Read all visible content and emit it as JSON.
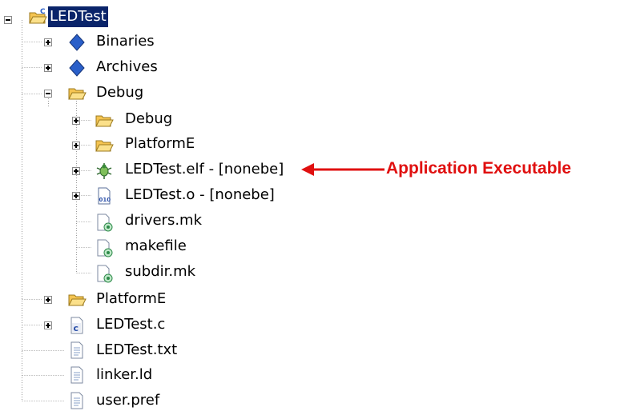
{
  "tree": {
    "root": {
      "label": "LEDTest",
      "icon": "c-project-folder-icon",
      "toggle": "-"
    },
    "items": [
      {
        "label": "Binaries",
        "icon": "binaries-icon",
        "toggle": "+"
      },
      {
        "label": "Archives",
        "icon": "archives-icon",
        "toggle": "+"
      },
      {
        "label": "Debug",
        "icon": "folder-open-icon",
        "toggle": "-"
      },
      {
        "label": "Debug",
        "icon": "folder-icon",
        "toggle": "+"
      },
      {
        "label": "PlatformE",
        "icon": "folder-icon",
        "toggle": "+"
      },
      {
        "label": "LEDTest.elf - [nonebe]",
        "icon": "executable-bug-icon",
        "toggle": "+"
      },
      {
        "label": "LEDTest.o - [nonebe]",
        "icon": "object-file-icon",
        "toggle": "+"
      },
      {
        "label": "drivers.mk",
        "icon": "make-file-icon"
      },
      {
        "label": "makefile",
        "icon": "make-file-icon"
      },
      {
        "label": "subdir.mk",
        "icon": "make-file-icon"
      },
      {
        "label": "PlatformE",
        "icon": "folder-icon",
        "toggle": "+"
      },
      {
        "label": "LEDTest.c",
        "icon": "c-source-file-icon",
        "toggle": "+"
      },
      {
        "label": "LEDTest.txt",
        "icon": "text-file-icon"
      },
      {
        "label": "linker.ld",
        "icon": "text-file-icon"
      },
      {
        "label": "user.pref",
        "icon": "text-file-icon"
      }
    ]
  },
  "annotation": {
    "text": "Application Executable",
    "color": "#e01010"
  },
  "colors": {
    "selection": "#0a246a",
    "tree_lines": "#9a9a9a",
    "folder": "#f5c451",
    "diamond": "#2a5fc9"
  }
}
